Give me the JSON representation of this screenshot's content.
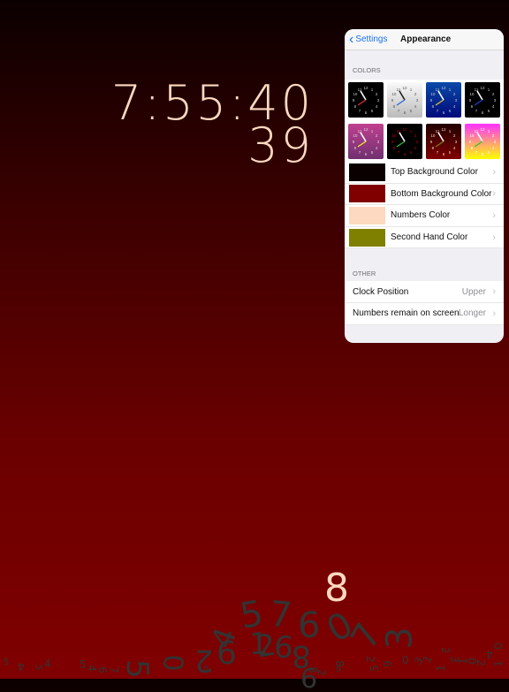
{
  "clock": {
    "time": "7:55:40",
    "seconds": "39"
  },
  "falling": {
    "highlight": "8",
    "digits": [
      "5",
      "7",
      "6",
      "0",
      "7",
      "3",
      "4",
      "2",
      "9",
      "1",
      "2",
      "6",
      "8",
      "5",
      "0",
      "3",
      "0",
      "9",
      "6",
      "5",
      "4",
      "5",
      "4",
      "5",
      "4",
      "6",
      "7",
      "8",
      "2",
      "5",
      "0",
      "1",
      "2",
      "3",
      "1",
      "0",
      "2",
      "4",
      "0",
      "1",
      "1",
      "3",
      "2",
      "9",
      "8"
    ]
  },
  "panel": {
    "back_label": "Settings",
    "title": "Appearance",
    "colors_header": "COLORS",
    "other_header": "OTHER",
    "themes": [
      {
        "bg": [
          "#000",
          "#000"
        ],
        "hand": "#e03030",
        "num": "#ccc"
      },
      {
        "bg": [
          "#fafafa",
          "#bbb"
        ],
        "hand": "#2266dd",
        "num": "#555"
      },
      {
        "bg": [
          "#0a4aa8",
          "#000a7a"
        ],
        "hand": "#e8c040",
        "num": "#ccc"
      },
      {
        "bg": [
          "#000",
          "#000"
        ],
        "hand": "#2040d0",
        "num": "#ccc"
      },
      {
        "bg": [
          "#c04090",
          "#703070"
        ],
        "hand": "#f0f020",
        "num": "#ddd"
      },
      {
        "bg": [
          "#000",
          "#000"
        ],
        "hand": "#30c030",
        "num": "#c00"
      },
      {
        "bg": [
          "#200000",
          "#800000"
        ],
        "hand": "#808000",
        "num": "#fcd9c0"
      },
      {
        "bg": [
          "#ff30ff",
          "#ffff00"
        ],
        "hand": "#30c030",
        "num": "#fff"
      }
    ],
    "color_rows": [
      {
        "label": "Top Background Color",
        "color": "#0a0000"
      },
      {
        "label": "Bottom Background Color",
        "color": "#800000"
      },
      {
        "label": "Numbers Color",
        "color": "#fcd9c0"
      },
      {
        "label": "Second Hand Color",
        "color": "#808000"
      }
    ],
    "other_rows": [
      {
        "label": "Clock Position",
        "value": "Upper"
      },
      {
        "label": "Numbers remain on screen",
        "value": "Longer"
      }
    ],
    "chevron": "›"
  }
}
